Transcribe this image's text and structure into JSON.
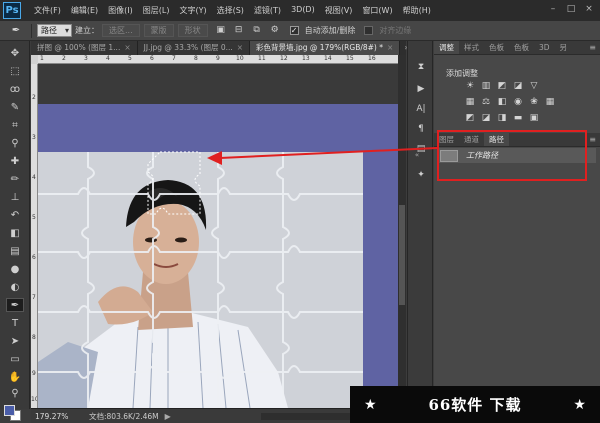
{
  "app": {
    "logo": "Ps"
  },
  "menu": [
    "文件(F)",
    "编辑(E)",
    "图像(I)",
    "图层(L)",
    "文字(Y)",
    "选择(S)",
    "滤镜(T)",
    "3D(D)",
    "视图(V)",
    "窗口(W)",
    "帮助(H)"
  ],
  "window_controls": {
    "minimize": "–",
    "restore": "□",
    "close": "×"
  },
  "options": {
    "mode": "路径",
    "build_label": "建立：",
    "selection_btn": "选区...",
    "mask_btn": "蒙版",
    "shape_btn": "形状",
    "auto_add_delete_label": "自动添加/删除",
    "auto_add_delete_checked": "✓",
    "align_edges_label": "对齐边缘"
  },
  "doc_tabs": [
    {
      "label": "拼图 @ 100% (图层 1...",
      "close": "×"
    },
    {
      "label": "JJ.jpg @ 33.3% (图层 0...",
      "close": "×"
    },
    {
      "label": "彩色背景墙.jpg @ 179%(RGB/8#) *",
      "close": "×"
    }
  ],
  "ruler": {
    "top_ticks": [
      "1",
      "2",
      "3",
      "4",
      "5",
      "6",
      "7",
      "8",
      "9",
      "10",
      "11",
      "12",
      "13",
      "14",
      "15",
      "16"
    ],
    "left_ticks": [
      "2",
      "3",
      "4",
      "5",
      "6",
      "7",
      "8",
      "9",
      "10"
    ]
  },
  "status": {
    "zoom": "179.27%",
    "doc_info": "文档:803.6K/2.46M",
    "arrow": "▶"
  },
  "panels": {
    "top_tabs": [
      "调整",
      "样式",
      "色板",
      "色板",
      "3D",
      "另"
    ],
    "adjust_title": "添加调整",
    "bottom_tabs": [
      "图层",
      "通道",
      "路径"
    ],
    "path_item": "工作路径"
  },
  "watermark": {
    "text": "66软件 下载",
    "star": "★"
  },
  "colors": {
    "accent_red": "#e02020",
    "canvas_blue": "#5f63a3",
    "foreground": "#4a5da8",
    "background": "#ffffff"
  },
  "icons": {
    "toolbar": [
      "move-icon",
      "marquee-icon",
      "lasso-icon",
      "quick-select-icon",
      "crop-icon",
      "eyedropper-icon",
      "healing-icon",
      "brush-icon",
      "stamp-icon",
      "history-brush-icon",
      "eraser-icon",
      "gradient-icon",
      "blur-icon",
      "dodge-icon",
      "pen-icon",
      "type-icon",
      "path-select-icon",
      "shape-icon",
      "hand-icon",
      "zoom-icon"
    ]
  }
}
